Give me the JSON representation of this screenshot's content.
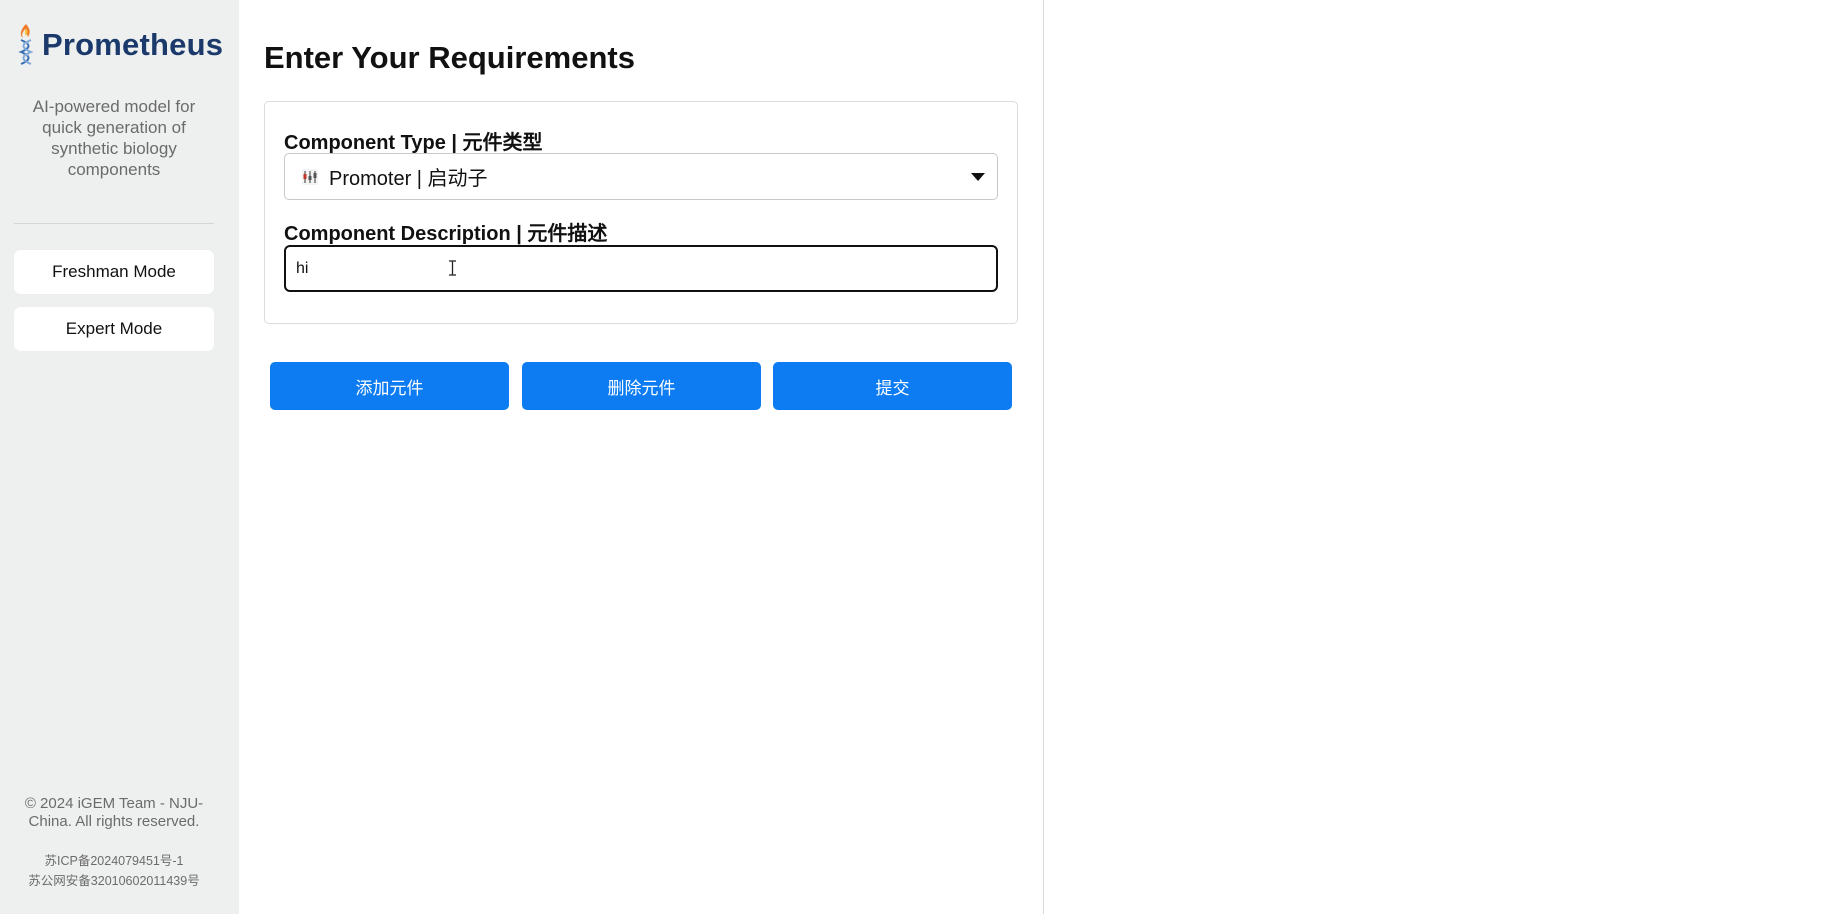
{
  "sidebar": {
    "brand_name": "Prometheus",
    "tagline": "AI-powered model for quick generation of synthetic biology components",
    "modes": [
      "Freshman Mode",
      "Expert Mode"
    ],
    "copyright": "© 2024 iGEM Team - NJU-China. All rights reserved.",
    "icp": "苏ICP备2024079451号-1",
    "police_record": "苏公网安备32010602011439号"
  },
  "main": {
    "title": "Enter Your Requirements",
    "component_type_label": "Component Type | 元件类型",
    "component_type_value": "Promoter | 启动子",
    "component_type_icon": "promoter-icon",
    "component_description_label": "Component Description | 元件描述",
    "component_description_value": "hi",
    "buttons": {
      "add": "添加元件",
      "delete": "删除元件",
      "submit": "提交"
    }
  },
  "colors": {
    "sidebar_bg": "#eef0ef",
    "brand": "#1b3a6b",
    "accent": "#0d7cf2"
  }
}
